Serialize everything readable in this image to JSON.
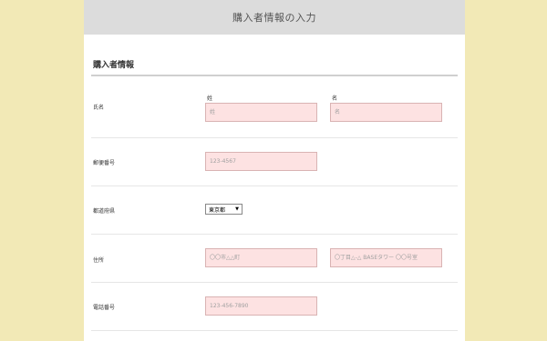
{
  "header": {
    "title": "購入者情報の入力"
  },
  "section": {
    "title": "購入者情報"
  },
  "name_row": {
    "label": "氏名",
    "last": {
      "label": "姓",
      "placeholder": "姓"
    },
    "first": {
      "label": "名",
      "placeholder": "名"
    }
  },
  "zip_row": {
    "label": "郵便番号",
    "placeholder": "123-4567"
  },
  "pref_row": {
    "label": "都道府県",
    "selected": "東京都"
  },
  "address_row": {
    "label": "住所",
    "city_placeholder": "〇〇市△△町",
    "building_placeholder": "〇丁目△-△ BASEタワー 〇〇号室"
  },
  "phone_row": {
    "label": "電話番号",
    "placeholder": "123-456-7890"
  },
  "colors": {
    "background": "#f2e9b6",
    "field_bg": "#fde2e2",
    "header_bg": "#dcdcdc"
  },
  "icons": {
    "select_arrow": "chevron-down-icon"
  }
}
